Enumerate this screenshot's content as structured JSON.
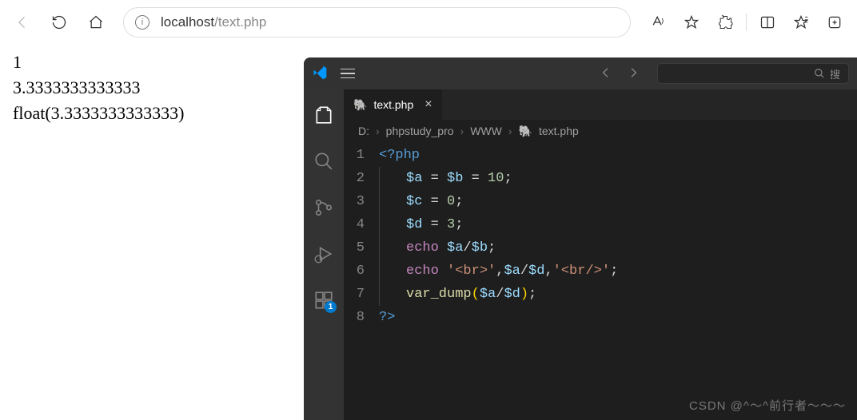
{
  "browser": {
    "url_host": "localhost",
    "url_path": "/text.php"
  },
  "page_output": {
    "line1": "1",
    "line2": "3.3333333333333",
    "line3": "float(3.3333333333333)"
  },
  "vscode": {
    "search_placeholder": "搜",
    "tab": {
      "icon": "🐘",
      "filename": "text.php"
    },
    "breadcrumb": {
      "parts": [
        "D:",
        "phpstudy_pro",
        "WWW"
      ],
      "file_icon": "🐘",
      "file": "text.php"
    },
    "activity_badge": "1",
    "line_numbers": [
      "1",
      "2",
      "3",
      "4",
      "5",
      "6",
      "7",
      "8"
    ],
    "code": {
      "l1_open": "<?php",
      "l2": {
        "a": "$a",
        "eq1": "=",
        "b": "$b",
        "eq2": "=",
        "v": "10",
        "sc": ";"
      },
      "l3": {
        "c": "$c",
        "eq": "=",
        "v": "0",
        "sc": ";"
      },
      "l4": {
        "d": "$d",
        "eq": "=",
        "v": "3",
        "sc": ";"
      },
      "l5": {
        "kw": "echo",
        "a": "$a",
        "sl": "/",
        "b": "$b",
        "sc": ";"
      },
      "l6": {
        "kw": "echo",
        "s1": "'<br>'",
        "c1": ",",
        "a": "$a",
        "sl": "/",
        "d": "$d",
        "c2": ",",
        "s2": "'<br/>'",
        "sc": ";"
      },
      "l7": {
        "fn": "var_dump",
        "lp": "(",
        "a": "$a",
        "sl": "/",
        "d": "$d",
        "rp": ")",
        "sc": ";"
      },
      "l8_close": "?>"
    }
  },
  "watermark": "CSDN @^～^前行者～～～"
}
